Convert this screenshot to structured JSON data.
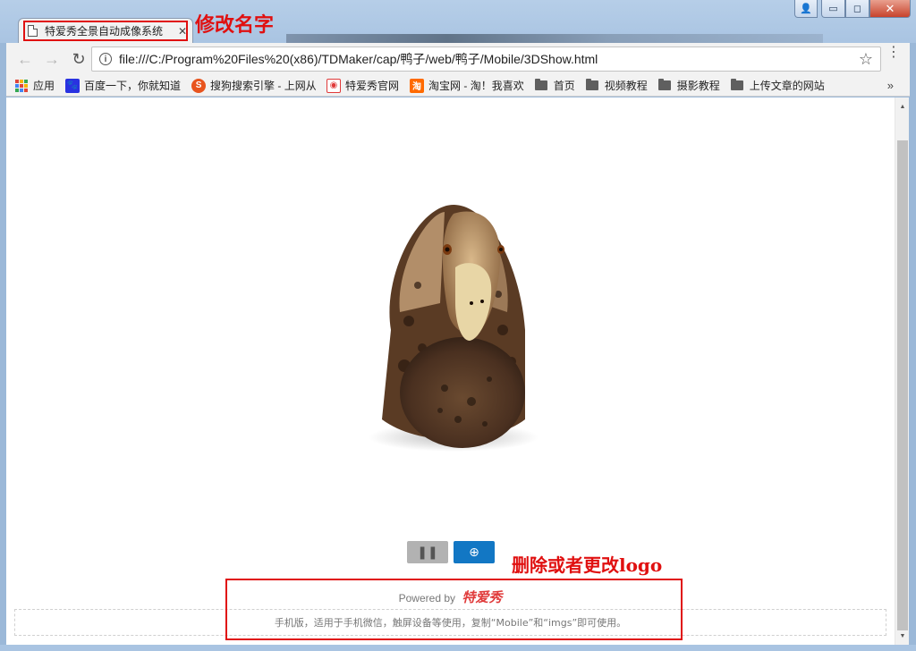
{
  "window": {
    "controls": {
      "user": "👤",
      "minimize": "▭",
      "maximize": "◻",
      "close": "✕"
    }
  },
  "tab": {
    "title": "特爱秀全景自动成像系统",
    "close": "✕"
  },
  "annotations": {
    "rename": "修改名字",
    "logo": "删除或者更改logo",
    "color": "#e01010"
  },
  "toolbar": {
    "back": "←",
    "forward": "→",
    "reload": "↻",
    "info": "i",
    "url": "file:///C:/Program%20Files%20(x86)/TDMaker/cap/鸭子/web/鸭子/Mobile/3DShow.html",
    "star": "☆",
    "menu": "⋮"
  },
  "bookmarks": {
    "items": [
      {
        "label": "应用",
        "icon": "apps-icon"
      },
      {
        "label": "百度一下，你就知道",
        "icon": "baidu-icon"
      },
      {
        "label": "搜狗搜索引擎 - 上网从",
        "icon": "sogou-icon"
      },
      {
        "label": "特爱秀官网",
        "icon": "camera-icon"
      },
      {
        "label": "淘宝网 - 淘！我喜欢",
        "icon": "taobao-icon"
      },
      {
        "label": "首页",
        "icon": "folder-icon"
      },
      {
        "label": "视频教程",
        "icon": "folder-icon"
      },
      {
        "label": "摄影教程",
        "icon": "folder-icon"
      },
      {
        "label": "上传文章的网站",
        "icon": "folder-icon"
      }
    ],
    "more": "»"
  },
  "viewer": {
    "pause_label": "❚❚",
    "zoom_label": "⊕"
  },
  "footer": {
    "powered_by": "Powered by",
    "brand": "特爱秀",
    "note": "手机版，适用于手机微信，触屏设备等使用，复制“Mobile”和“imgs”即可使用。"
  }
}
